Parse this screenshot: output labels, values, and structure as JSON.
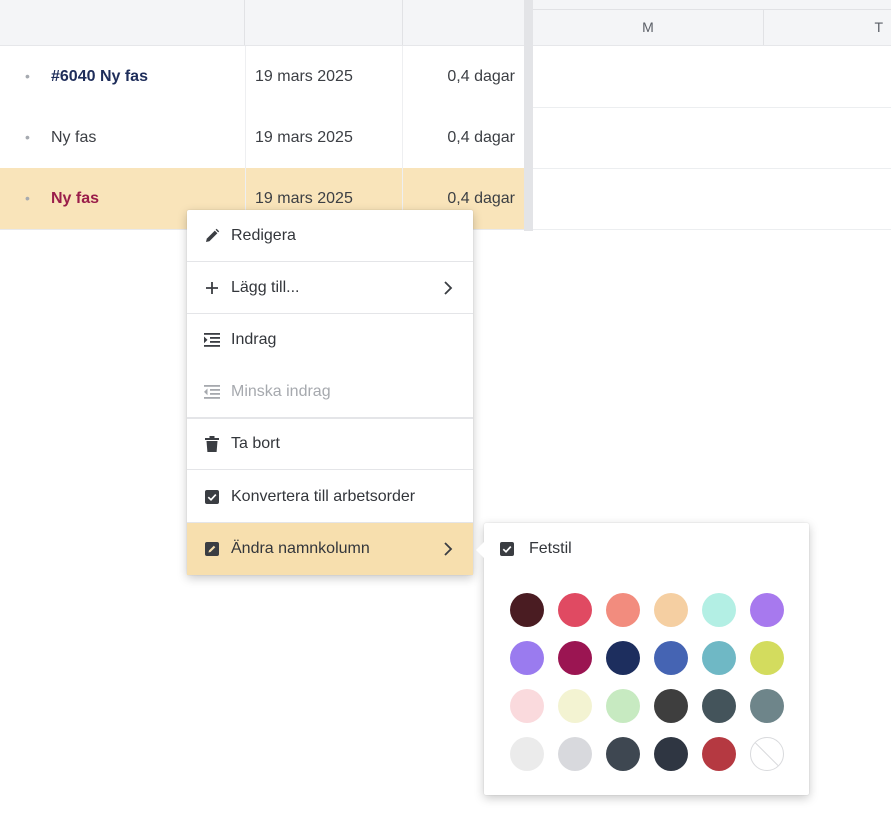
{
  "table": {
    "rows": [
      {
        "name": "#6040 Ny fas",
        "date": "19 mars 2025",
        "duration": "0,4 dagar",
        "bullet": "•"
      },
      {
        "name": "Ny fas",
        "date": "19 mars 2025",
        "duration": "0,4 dagar",
        "bullet": "•"
      },
      {
        "name": "Ny fas",
        "date": "19 mars 2025",
        "duration": "0,4 dagar",
        "bullet": "•"
      }
    ]
  },
  "gantt": {
    "days": [
      "M",
      "T"
    ]
  },
  "context_menu": {
    "items": [
      {
        "label": "Redigera",
        "icon": "pencil-icon"
      },
      {
        "label": "Lägg till...",
        "icon": "plus-icon",
        "submenu": true
      },
      {
        "label": "Indrag",
        "icon": "indent-icon"
      },
      {
        "label": "Minska indrag",
        "icon": "outdent-icon",
        "disabled": true
      },
      {
        "label": "Ta bort",
        "icon": "trash-icon"
      },
      {
        "label": "Konvertera till arbetsorder",
        "icon": "checkbox-icon"
      },
      {
        "label": "Ändra namnkolumn",
        "icon": "edit-square-icon",
        "submenu": true,
        "active": true
      }
    ]
  },
  "name_column_submenu": {
    "bold_label": "Fetstil",
    "bold_checked": true,
    "colors": [
      "#4a1c22",
      "#e04a62",
      "#f28c7e",
      "#f5cfa2",
      "#b3efe4",
      "#a779ee",
      "#9a7bef",
      "#9b1552",
      "#1d2e5e",
      "#4564b3",
      "#6fb8c5",
      "#d3dc5e",
      "#fadadd",
      "#f3f3d2",
      "#c7eac1",
      "#3e3e3e",
      "#44545b",
      "#6e858a",
      "#ebebeb",
      "#d8d9dd",
      "#3e4751",
      "#2f3642",
      "#b53941",
      "none"
    ]
  },
  "colors": {
    "selected_row": "#f9e4ba",
    "active_menu_item": "#f7dfae",
    "bold_navy": "#1e2d5a",
    "bold_wine": "#9a1d4a"
  }
}
